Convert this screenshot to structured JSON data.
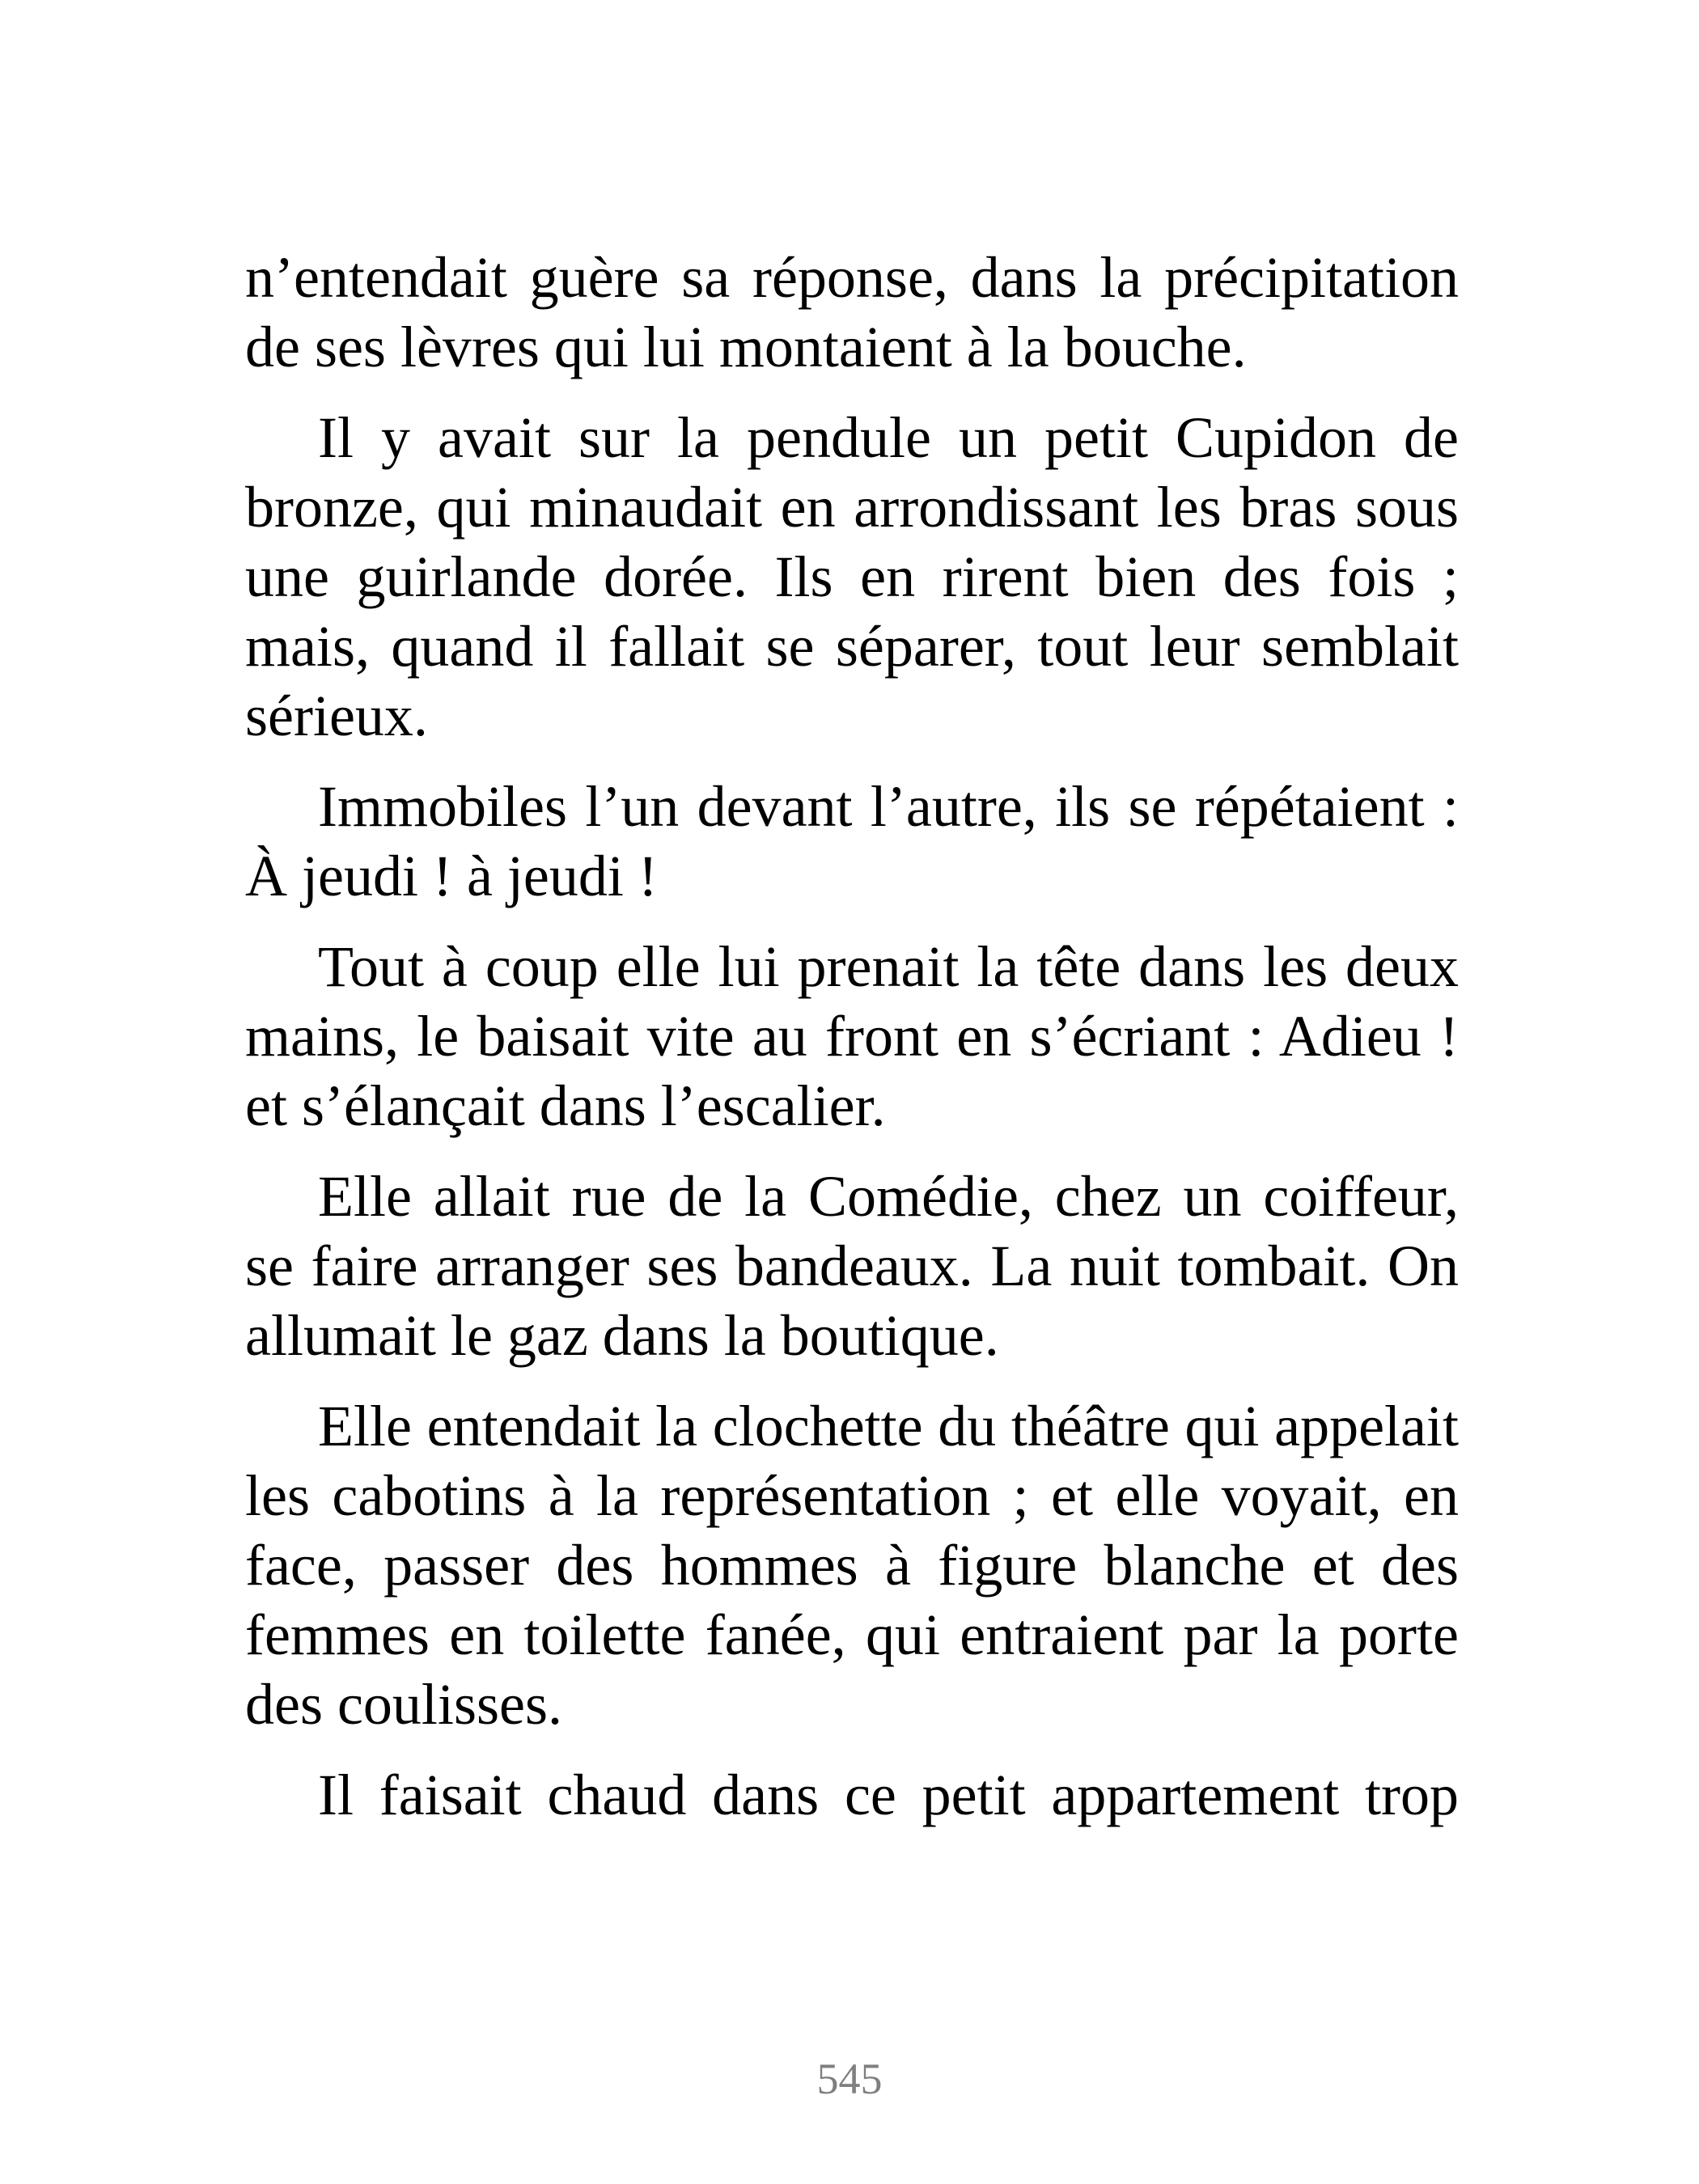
{
  "paragraphs": [
    "n’entendait guère sa réponse, dans la précipitation de ses lèvres qui lui montaient à la bouche.",
    "Il y avait sur la pendule un petit Cupidon de bronze, qui minaudait en arrondissant les bras sous une guirlande dorée. Ils en rirent bien des fois ; mais, quand il fallait se séparer, tout leur semblait sérieux.",
    "Immobiles l’un devant l’autre, ils se répétaient : À jeudi ! à jeudi !",
    "Tout à coup elle lui prenait la tête dans les deux mains, le baisait vite au front en s’écriant : Adieu ! et s’élançait dans l’escalier.",
    "Elle allait rue de la Comédie, chez un coiffeur, se faire arranger ses bandeaux. La nuit tombait. On allumait le gaz dans la boutique.",
    "Elle entendait la clochette du théâtre qui appelait les cabotins à la représentation ; et elle voyait, en face, passer des hommes à figure blanche et des femmes en toilette fanée, qui entraient par la porte des coulisses.",
    "Il faisait chaud dans ce petit appartement trop"
  ],
  "page_number": "545"
}
